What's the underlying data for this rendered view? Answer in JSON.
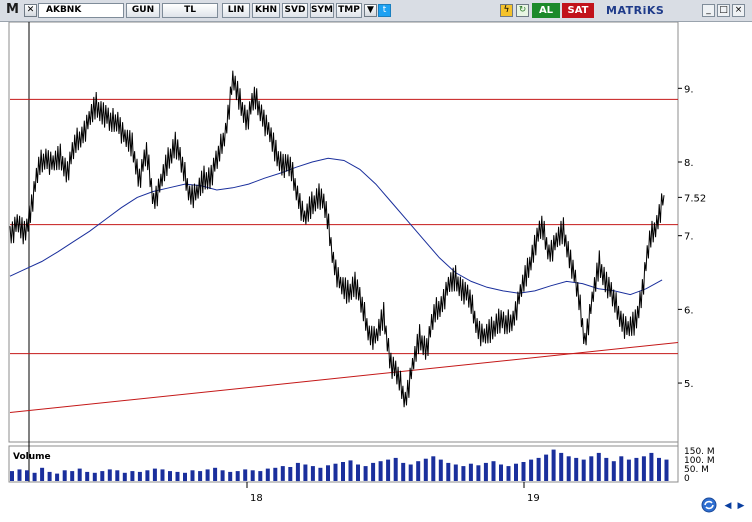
{
  "toolbar": {
    "m_label": "M",
    "symbol": "AKBNK",
    "buttons": [
      "GUN",
      "TL",
      "LIN",
      "KHN",
      "SVD",
      "SYM",
      "TMP"
    ],
    "buy": "AL",
    "sell": "SAT",
    "brand": "MATRiKS",
    "window_controls": [
      "_",
      "□",
      "×"
    ],
    "accent": "#1c8a2b",
    "sell_color": "#c2131b"
  },
  "chart_data": {
    "type": "line",
    "title": "",
    "ylim": [
      4.2,
      9.9
    ],
    "y_ticks": [
      5,
      6,
      7,
      8,
      9
    ],
    "y_tick_labels": [
      "5.",
      "6.",
      "7.",
      "8.",
      "9."
    ],
    "last_price_label": "7.52",
    "last_price": 7.52,
    "x_tick_labels": [
      "18",
      "19"
    ],
    "horizontal_levels": [
      8.85,
      7.15,
      5.4
    ],
    "trendline": {
      "from": 4.6,
      "to": 5.55
    },
    "moving_average_color": "#1a2f9c",
    "level_color": "#c41818",
    "grid": false,
    "price_series": [
      7.05,
      7.15,
      7.0,
      7.45,
      7.9,
      8.1,
      7.95,
      8.05,
      7.9,
      8.2,
      8.4,
      8.55,
      8.75,
      8.7,
      8.5,
      8.6,
      8.3,
      8.2,
      7.8,
      8.1,
      7.5,
      7.7,
      8.0,
      8.3,
      7.9,
      7.6,
      7.55,
      7.75,
      7.85,
      8.05,
      8.45,
      9.1,
      8.8,
      8.6,
      8.85,
      8.7,
      8.4,
      8.1,
      8.0,
      7.9,
      7.6,
      7.2,
      7.4,
      7.6,
      7.3,
      6.7,
      6.3,
      6.2,
      6.4,
      6.0,
      5.7,
      5.6,
      5.9,
      5.3,
      5.05,
      4.8,
      5.2,
      5.6,
      5.5,
      5.9,
      6.1,
      6.3,
      6.4,
      6.3,
      6.1,
      5.8,
      5.6,
      5.7,
      5.9,
      5.75,
      5.9,
      6.2,
      6.5,
      6.9,
      7.1,
      6.8,
      6.9,
      7.05,
      6.7,
      6.2,
      5.6,
      6.1,
      6.6,
      6.4,
      6.1,
      5.9,
      5.7,
      5.8,
      6.3,
      6.9,
      7.2,
      7.55
    ],
    "ma_series": [
      6.45,
      6.55,
      6.65,
      6.78,
      6.92,
      7.06,
      7.22,
      7.38,
      7.52,
      7.6,
      7.65,
      7.7,
      7.68,
      7.62,
      7.65,
      7.7,
      7.78,
      7.85,
      7.93,
      8.0,
      8.05,
      8.02,
      7.9,
      7.7,
      7.45,
      7.2,
      6.95,
      6.7,
      6.5,
      6.38,
      6.3,
      6.25,
      6.22,
      6.25,
      6.32,
      6.38,
      6.35,
      6.28,
      6.25,
      6.2,
      6.28,
      6.4
    ],
    "volume_label": "Volume",
    "volume_axis_labels": [
      "150. M",
      "100. M",
      "50. M",
      "0"
    ],
    "volume_series": [
      12,
      14,
      13,
      10,
      16,
      11,
      9,
      13,
      12,
      15,
      11,
      10,
      12,
      14,
      13,
      10,
      12,
      11,
      13,
      15,
      14,
      12,
      11,
      10,
      13,
      12,
      14,
      16,
      13,
      11,
      12,
      14,
      13,
      12,
      15,
      16,
      18,
      17,
      22,
      20,
      18,
      16,
      19,
      21,
      23,
      25,
      20,
      18,
      22,
      24,
      26,
      28,
      22,
      20,
      24,
      27,
      30,
      26,
      22,
      20,
      18,
      21,
      19,
      22,
      24,
      20,
      18,
      21,
      23,
      26,
      28,
      32,
      38,
      34,
      30,
      28,
      26,
      30,
      34,
      28,
      24,
      30,
      26,
      28,
      30,
      34,
      28,
      26
    ]
  }
}
